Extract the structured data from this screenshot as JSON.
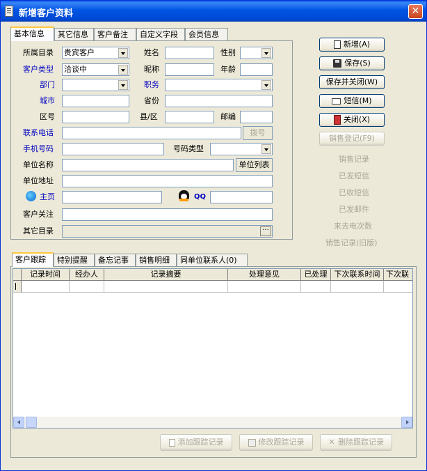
{
  "window": {
    "title": "新增客户资料",
    "close_glyph": "✕"
  },
  "top_tabs": [
    "基本信息",
    "其它信息",
    "客户备注",
    "自定义字段",
    "会员信息"
  ],
  "form": {
    "category_label": "所属目录",
    "category_value": "贵宾客户",
    "name_label": "姓名",
    "name_value": "",
    "gender_label": "性别",
    "gender_value": "",
    "type_label": "客户类型",
    "type_value": "洽谈中",
    "nickname_label": "昵称",
    "age_label": "年龄",
    "dept_label": "部门",
    "position_label": "职务",
    "city_label": "城市",
    "province_label": "省份",
    "area_code_label": "区号",
    "county_label": "县/区",
    "postcode_label": "邮编",
    "phone_label": "联系电话",
    "dial_button": "拨号",
    "mobile_label": "手机号码",
    "number_type_label": "号码类型",
    "company_label": "单位名称",
    "company_list_button": "单位列表",
    "address_label": "单位地址",
    "homepage_label": "主页",
    "qq_label": "QQ",
    "attention_label": "客户关注",
    "other_dir_label": "其它目录",
    "other_dir_button": "···"
  },
  "side_buttons": {
    "new": "新增(A)",
    "save": "保存(S)",
    "save_close": "保存并关闭(W)",
    "sms": "短信(M)",
    "close": "关闭(X)",
    "sales_register": "销售登记(F9)"
  },
  "side_links": [
    "销售记录",
    "已发短信",
    "已收短信",
    "已发邮件",
    "来去电次数",
    "销售记录(旧版)"
  ],
  "bottom_tabs": [
    "客户跟踪",
    "特别提醒",
    "备忘记事",
    "销售明细",
    "同单位联系人(0)"
  ],
  "table": {
    "columns": [
      "记录时间",
      "经办人",
      "记录摘要",
      "处理意见",
      "已处理",
      "下次联系时间",
      "下次联"
    ]
  },
  "bottom_buttons": {
    "add": "添加跟踪记录",
    "edit": "修改跟踪记录",
    "delete": "删除跟踪记录"
  },
  "colors": {
    "title_bar": "#0054e3",
    "label_blue": "#0000c0",
    "disabled": "#aca899",
    "tab_highlight": "#ffc83c"
  }
}
